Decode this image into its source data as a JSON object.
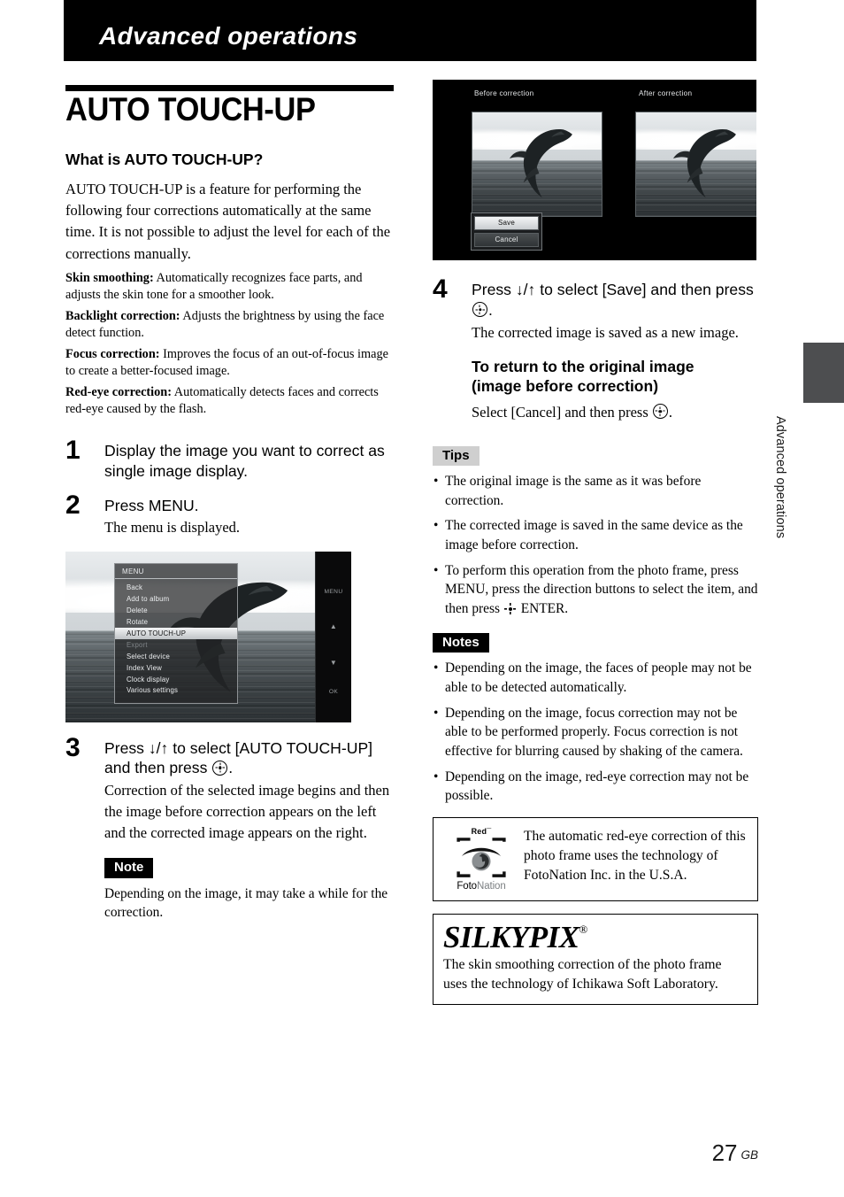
{
  "banner": {
    "title": "Advanced operations"
  },
  "section": {
    "title": "AUTO TOUCH-UP"
  },
  "intro": {
    "subhead": "What is AUTO TOUCH-UP?",
    "paragraph": "AUTO TOUCH-UP is a feature for performing the following four corrections automatically at the same time. It is not possible to adjust the level for each of the corrections manually.",
    "features": [
      {
        "term": "Skin smoothing:",
        "desc": " Automatically recognizes face parts, and adjusts the skin tone for a smoother look."
      },
      {
        "term": "Backlight correction:",
        "desc": " Adjusts the brightness by using the face detect function."
      },
      {
        "term": "Focus correction:",
        "desc": " Improves the focus of  an out-of-focus image to create a better-focused image."
      },
      {
        "term": "Red-eye correction:",
        "desc": " Automatically detects faces and corrects red-eye caused by the flash."
      }
    ]
  },
  "steps": {
    "one": {
      "num": "1",
      "head": "Display the image you want to correct as single image display."
    },
    "two": {
      "num": "2",
      "head": "Press MENU.",
      "body": "The menu is displayed."
    },
    "three": {
      "num": "3",
      "head_a": "Press ↓/↑ to select [AUTO TOUCH-UP] and then press",
      "head_b": ".",
      "body": "Correction of the selected image begins and then the image before correction appears on the left and the corrected image appears on the right."
    },
    "four": {
      "num": "4",
      "head_a": "Press ↓/↑ to select [Save] and then press",
      "head_b": ".",
      "body": "The corrected image is saved as a new image."
    }
  },
  "menu_screenshot": {
    "panel_title": "MENU",
    "items": [
      {
        "label": "Back",
        "state": "normal"
      },
      {
        "label": "Add to album",
        "state": "normal"
      },
      {
        "label": "Delete",
        "state": "normal"
      },
      {
        "label": "Rotate",
        "state": "normal"
      },
      {
        "label": "AUTO TOUCH-UP",
        "state": "selected"
      },
      {
        "label": "Export",
        "state": "disabled"
      },
      {
        "label": "Select device",
        "state": "normal"
      },
      {
        "label": "Index View",
        "state": "normal"
      },
      {
        "label": "Clock display",
        "state": "normal"
      },
      {
        "label": "Various settings",
        "state": "normal"
      }
    ],
    "side_keys": [
      "MENU",
      "▲",
      "▼",
      "OK"
    ]
  },
  "compare_screenshot": {
    "label_before": "Before correction",
    "label_after": "After correction",
    "buttons": [
      {
        "label": "Save",
        "state": "selected"
      },
      {
        "label": "Cancel",
        "state": "normal"
      }
    ]
  },
  "note_step3": {
    "tag": "Note",
    "text": "Depending on the image, it may take a while for the correction."
  },
  "return_original": {
    "heading_line1": "To return to the original image",
    "heading_line2": "(image before correction)",
    "body_a": "Select [Cancel] and then press",
    "body_b": "."
  },
  "tips": {
    "tag": "Tips",
    "items": [
      {
        "text": "The original image is the same as it was before correction."
      },
      {
        "text": "The corrected image is saved in the same device as the image before correction."
      },
      {
        "text_a": "To perform this operation from the photo frame, press MENU, press the direction buttons to select the item, and then press",
        "text_b": "ENTER."
      }
    ]
  },
  "notes": {
    "tag": "Notes",
    "items": [
      "Depending on the image, the faces of people may not be able to be detected automatically.",
      "Depending on the image, focus correction may not be able to be performed properly. Focus correction is not effective for blurring caused by shaking of the camera.",
      "Depending on the image, red-eye correction may not be possible."
    ]
  },
  "fotonation": {
    "mark_top_label": "Red",
    "mark_top_sup": "¯",
    "name_a": "Foto",
    "name_b": "Nation",
    "text": "The automatic red-eye correction of this photo frame uses the technology of FotoNation Inc. in the U.S.A."
  },
  "silkypix": {
    "wordmark": "SILKYPIX",
    "registered": "®",
    "text": "The skin smoothing correction of the photo frame uses the technology of Ichikawa Soft Laboratory."
  },
  "edge_tab": {
    "label": "Advanced operations"
  },
  "footer": {
    "page": "27",
    "locale": "GB"
  },
  "colors": {
    "banner_bg": "#000000",
    "tag_dark_bg": "#000000",
    "tag_gray_bg": "#cfcfcf",
    "edge_tab_bg": "#4d4e50"
  }
}
